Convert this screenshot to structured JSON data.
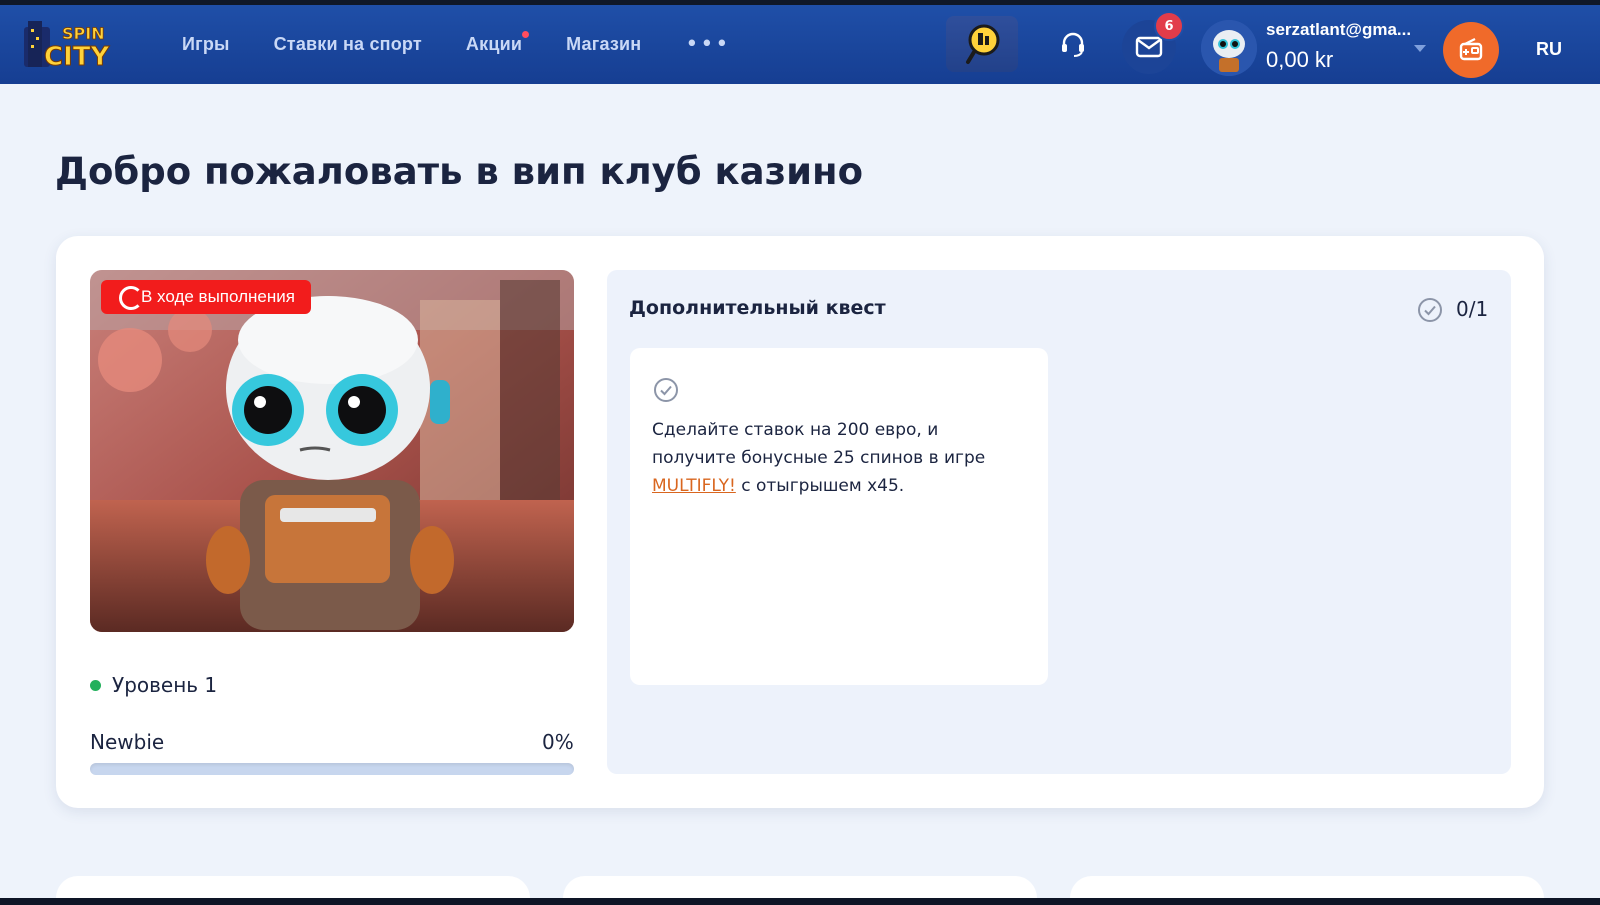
{
  "header": {
    "logo_text": "SPIN CITY",
    "nav": [
      {
        "label": "Игры",
        "dot": false
      },
      {
        "label": "Ставки на спорт",
        "dot": false
      },
      {
        "label": "Акции",
        "dot": true
      },
      {
        "label": "Магазин",
        "dot": false
      }
    ],
    "more_label": "•••",
    "mail_badge": "6",
    "user_email": "serzatlant@gma...",
    "balance": "0,00 kr",
    "language": "RU",
    "colors": {
      "header_bg": "#1f4fa8",
      "badge": "#e23c4a",
      "cashier": "#f06a2a"
    }
  },
  "page": {
    "title": "Добро пожаловать в вип клуб казино"
  },
  "vip": {
    "status_label": "В ходе выполнения",
    "level_label": "Уровень 1",
    "rank_name": "Newbie",
    "progress_label": "0%",
    "progress_value": 0
  },
  "quest": {
    "title": "Дополнительный квест",
    "count": "0/1",
    "task_text_before": "Сделайте ставок на 200 евро, и получите бонусные 25 спинов в игре ",
    "task_link": "MULTIFLY!",
    "task_text_after": " с отыгрышем x45."
  }
}
